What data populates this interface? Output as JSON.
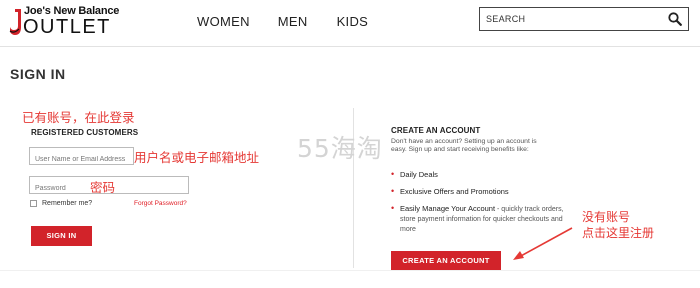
{
  "header": {
    "logo_top": "Joe's New Balance",
    "logo_bottom": "OUTLET",
    "nav": [
      "WOMEN",
      "MEN",
      "KIDS"
    ],
    "search_placeholder": "SEARCH",
    "search_icon": "magnifier-icon"
  },
  "page": {
    "title": "SIGN IN"
  },
  "login": {
    "annotation": "已有账号，在此登录",
    "heading": "REGISTERED CUSTOMERS",
    "username_placeholder": "User Name or Email Address",
    "username_annotation": "用户名或电子邮箱地址",
    "password_placeholder": "Password",
    "password_annotation": "密码",
    "remember_label": "Remember me?",
    "forgot_link": "Forgot Password?",
    "sign_in_button": "SIGN IN"
  },
  "create": {
    "heading": "CREATE AN ACCOUNT",
    "description": "Don't have an account? Setting up an account is easy. Sign up and start receiving benefits like:",
    "benefits": [
      {
        "title": "Daily Deals",
        "detail": ""
      },
      {
        "title": "Exclusive Offers and Promotions",
        "detail": ""
      },
      {
        "title": "Easily Manage Your Account",
        "detail": " - quickly track orders, store payment information for quicker checkouts and more"
      }
    ],
    "button": "CREATE AN ACCOUNT",
    "annotation_line1": "没有账号",
    "annotation_line2": "点击这里注册"
  },
  "watermark": "55海淘",
  "colors": {
    "accent": "#d2232a",
    "annotation": "#e53935"
  }
}
